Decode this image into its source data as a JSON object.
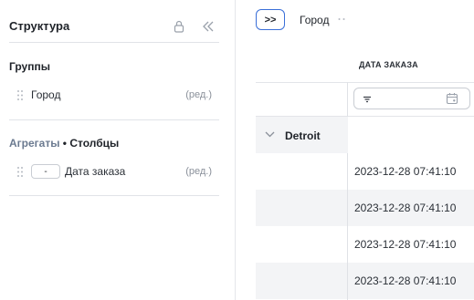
{
  "panel": {
    "title": "Структура",
    "groups": {
      "title": "Группы",
      "items": [
        {
          "label": "Город",
          "edit": "(ред.)"
        }
      ]
    },
    "aggregates": {
      "title_muted": "Агрегаты",
      "title_sep": " • ",
      "title_main": "Столбцы",
      "items": [
        {
          "agg": "-",
          "label": "Дата заказа",
          "edit": "(ред.)"
        }
      ]
    }
  },
  "toolbar": {
    "toggle_label": ">>",
    "group_chip": "Город"
  },
  "table": {
    "column_header": "ДАТА ЗАКАЗА",
    "group_row": "Detroit",
    "rows": [
      "2023-12-28 07:41:10",
      "2023-12-28 07:41:10",
      "2023-12-28 07:41:10",
      "2023-12-28 07:41:10"
    ]
  },
  "colors": {
    "accent": "#3a6fd8",
    "muted": "#6b7a90",
    "band": "#f3f4f6"
  },
  "icons": [
    "lock-icon",
    "collapse-left-icon",
    "drag-handle-icon",
    "filter-icon",
    "calendar-icon",
    "chevron-down-icon"
  ]
}
